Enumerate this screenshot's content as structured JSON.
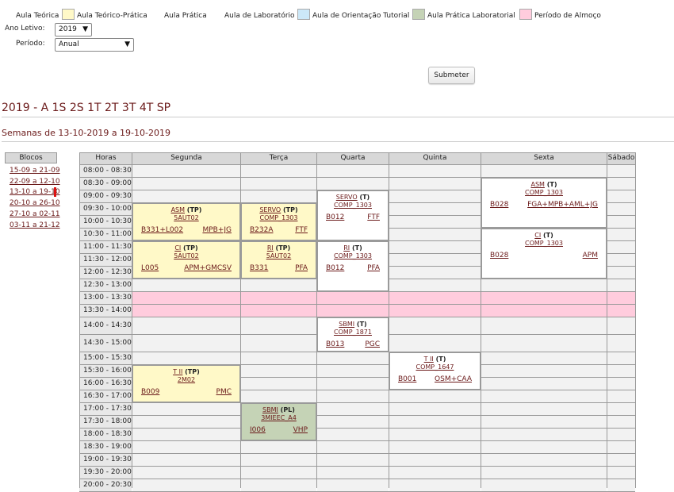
{
  "legend": [
    {
      "label": "Aula Teórica",
      "color": ""
    },
    {
      "label": "Aula Teórico-Prática",
      "color": "#fff9c8"
    },
    {
      "label": "Aula Prática",
      "color": ""
    },
    {
      "label": "Aula de Laboratório",
      "color": ""
    },
    {
      "label": "Aula de Orientação Tutorial",
      "color": "#cce8f8"
    },
    {
      "label": "Aula Prática Laboratorial",
      "color": "#c5d3b6"
    },
    {
      "label": "Período de Almoço",
      "color": "#ffccdd"
    }
  ],
  "form": {
    "ano_label": "Ano Letivo:",
    "ano_value": "2019",
    "periodo_label": "Período:",
    "periodo_value": "Anual",
    "submit_label": "Submeter"
  },
  "heading": "2019 - A 1S 2S 1T 2T 3T 4T SP",
  "week": "Semanas de 13-10-2019 a 19-10-2019",
  "blocos": {
    "title": "Blocos",
    "items": [
      "15-09 a 21-09",
      "22-09 a 12-10",
      "13-10 a 19-10",
      "20-10 a 26-10",
      "27-10 a 02-11",
      "03-11 a 21-12"
    ],
    "selected": "13-10 a 19-10"
  },
  "schedule": {
    "columns": [
      "Horas",
      "Segunda",
      "Terça",
      "Quarta",
      "Quinta",
      "Sexta",
      "Sábado"
    ],
    "hours": [
      "08:00 - 08:30",
      "08:30 - 09:00",
      "09:00 - 09:30",
      "09:30 - 10:00",
      "10:00 - 10:30",
      "10:30 - 11:00",
      "11:00 - 11:30",
      "11:30 - 12:00",
      "12:00 - 12:30",
      "12:30 - 13:00",
      "13:00 - 13:30",
      "13:30 - 14:00",
      "14:00 - 14:30",
      "14:30 - 15:00",
      "15:00 - 15:30",
      "15:30 - 16:00",
      "16:00 - 16:30",
      "16:30 - 17:00",
      "17:00 - 17:30",
      "17:30 - 18:00",
      "18:00 - 18:30",
      "18:30 - 19:00",
      "19:00 - 19:30",
      "19:30 - 20:00",
      "20:00 - 20:30"
    ],
    "events": [
      {
        "name": "ASM",
        "type": "(TP)",
        "group": "5AUT02",
        "room": "B331+L002",
        "teacher": "MPB+JG",
        "color": "#fff9c8"
      },
      {
        "name": "CI",
        "type": "(TP)",
        "group": "5AUT02",
        "room": "L005",
        "teacher": "APM+GMCSV",
        "color": "#fff9c8"
      },
      {
        "name": "T II",
        "type": "(TP)",
        "group": "2M02",
        "room": "B009",
        "teacher": "PMC",
        "color": "#fff9c8"
      },
      {
        "name": "SERVO",
        "type": "(TP)",
        "group": "COMP_1303",
        "room": "B232A",
        "teacher": "FTF",
        "color": "#fff9c8"
      },
      {
        "name": "RI",
        "type": "(TP)",
        "group": "5AUT02",
        "room": "B331",
        "teacher": "PFA",
        "color": "#fff9c8"
      },
      {
        "name": "SBMI",
        "type": "(PL)",
        "group": "3MIEEC_A4",
        "room": "I006",
        "teacher": "VHP",
        "color": "#c5d3b6"
      },
      {
        "name": "SERVO",
        "type": "(T)",
        "group": "COMP_1303",
        "room": "B012",
        "teacher": "FTF",
        "color": "#ffffff"
      },
      {
        "name": "RI",
        "type": "(T)",
        "group": "COMP_1303",
        "room": "B012",
        "teacher": "PFA",
        "color": "#ffffff"
      },
      {
        "name": "SBMI",
        "type": "(T)",
        "group": "COMP_1871",
        "room": "B013",
        "teacher": "PGC",
        "color": "#ffffff"
      },
      {
        "name": "T II",
        "type": "(T)",
        "group": "COMP_1647",
        "room": "B001",
        "teacher": "OSM+CAA",
        "color": "#ffffff"
      },
      {
        "name": "ASM",
        "type": "(T)",
        "group": "COMP_1303",
        "room": "B028",
        "teacher": "FGA+MPB+AML+JG",
        "color": "#ffffff"
      },
      {
        "name": "CI",
        "type": "(T)",
        "group": "COMP_1303",
        "room": "B028",
        "teacher": "APM",
        "color": "#ffffff"
      }
    ],
    "lunch_color": "#ffccdd"
  }
}
